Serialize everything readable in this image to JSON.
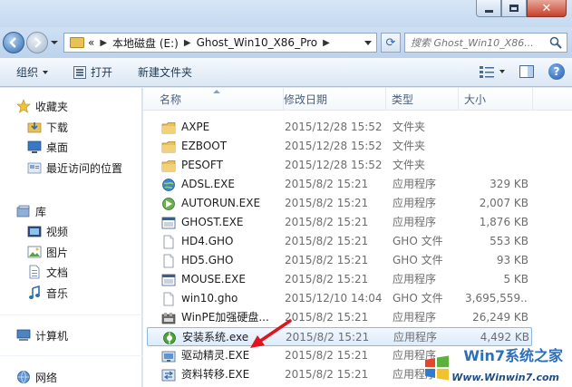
{
  "address": {
    "prefix": "«",
    "crumbs": [
      "本地磁盘 (E:)",
      "Ghost_Win10_X86_Pro"
    ],
    "search_placeholder": "搜索 Ghost_Win10_X86..."
  },
  "toolbar": {
    "organize": "组织",
    "open": "打开",
    "new_folder": "新建文件夹"
  },
  "sidebar": {
    "favorites": "收藏夹",
    "downloads": "下载",
    "desktop": "桌面",
    "recent": "最近访问的位置",
    "libraries": "库",
    "videos": "视频",
    "pictures": "图片",
    "documents": "文档",
    "music": "音乐",
    "computer": "计算机",
    "network": "网络"
  },
  "columns": {
    "name": "名称",
    "date": "修改日期",
    "type": "类型",
    "size": "大小"
  },
  "files": [
    {
      "name": "AXPE",
      "date": "2015/12/28 15:52",
      "type": "文件夹",
      "size": "",
      "icon": "folder-icon"
    },
    {
      "name": "EZBOOT",
      "date": "2015/12/28 15:52",
      "type": "文件夹",
      "size": "",
      "icon": "folder-icon"
    },
    {
      "name": "PESOFT",
      "date": "2015/12/28 15:52",
      "type": "文件夹",
      "size": "",
      "icon": "folder-icon"
    },
    {
      "name": "ADSL.EXE",
      "date": "2015/8/2 15:21",
      "type": "应用程序",
      "size": "329 KB",
      "icon": "network-globe-icon"
    },
    {
      "name": "AUTORUN.EXE",
      "date": "2015/8/2 15:21",
      "type": "应用程序",
      "size": "2,007 KB",
      "icon": "autorun-icon"
    },
    {
      "name": "GHOST.EXE",
      "date": "2015/8/2 15:21",
      "type": "应用程序",
      "size": "1,876 KB",
      "icon": "ghost-window-icon"
    },
    {
      "name": "HD4.GHO",
      "date": "2015/8/2 15:21",
      "type": "GHO 文件",
      "size": "553 KB",
      "icon": "blank-file-icon"
    },
    {
      "name": "HD5.GHO",
      "date": "2015/8/2 15:21",
      "type": "GHO 文件",
      "size": "93 KB",
      "icon": "blank-file-icon"
    },
    {
      "name": "MOUSE.EXE",
      "date": "2015/8/2 15:21",
      "type": "应用程序",
      "size": "5 KB",
      "icon": "ghost-window-icon"
    },
    {
      "name": "win10.gho",
      "date": "2015/12/10 14:04",
      "type": "GHO 文件",
      "size": "3,695,559...",
      "icon": "blank-file-icon"
    },
    {
      "name": "WinPE加强硬盘...",
      "date": "2015/8/2 15:21",
      "type": "应用程序",
      "size": "26,249 KB",
      "icon": "winpe-icon"
    },
    {
      "name": "安装系统.exe",
      "date": "2015/8/2 15:21",
      "type": "应用程序",
      "size": "4,492 KB",
      "icon": "install-system-icon",
      "selected": true
    },
    {
      "name": "驱动精灵.EXE",
      "date": "2015/8/2 15:21",
      "type": "应用程序",
      "size": "",
      "icon": "driver-icon"
    },
    {
      "name": "资料转移.EXE",
      "date": "2015/8/2 15:21",
      "type": "应用程序",
      "size": "",
      "icon": "transfer-icon"
    }
  ],
  "watermark": {
    "title": "Win7系统之家",
    "url": "Www.Winwin7.com"
  },
  "colors": {
    "selection_border": "#8fb7e6",
    "selection_fill": "#dcebfc",
    "arrow": "#e0141e",
    "folder": "#e8c257"
  }
}
